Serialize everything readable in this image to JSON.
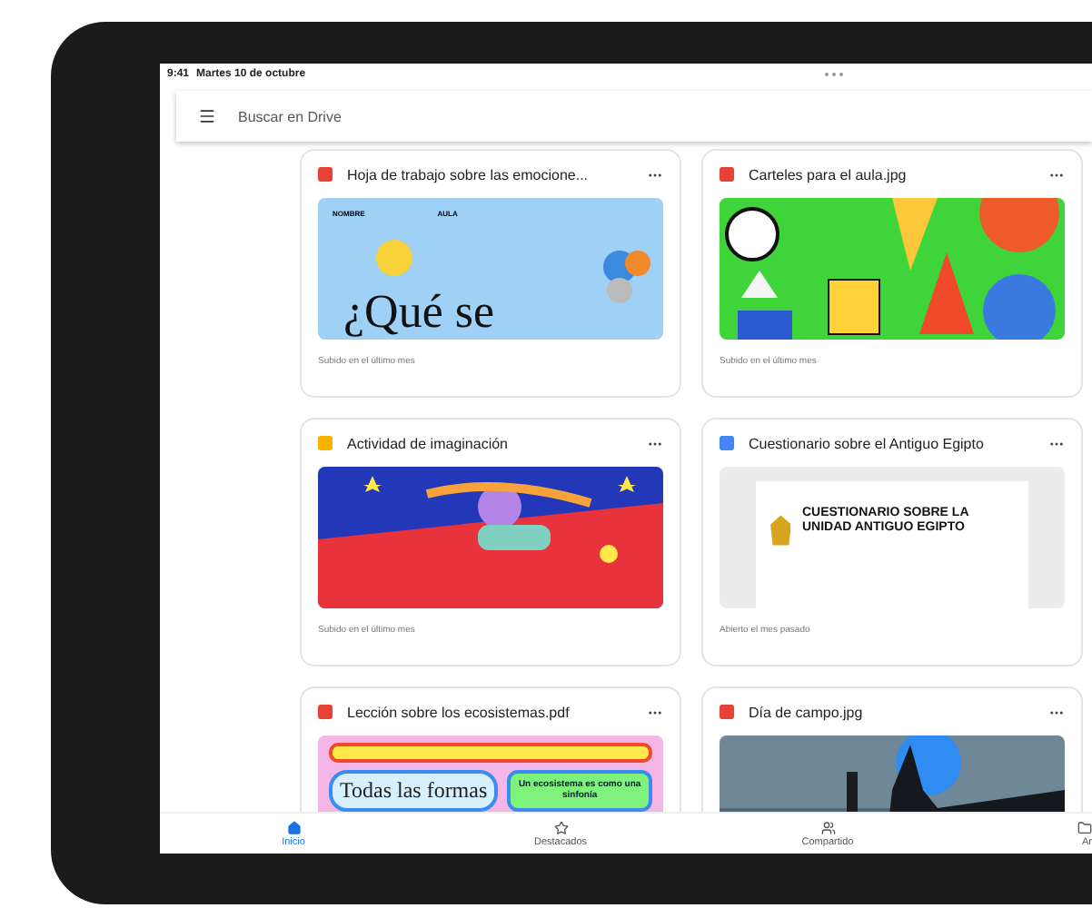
{
  "status_bar": {
    "time": "9:41",
    "date": "Martes 10 de octubre"
  },
  "search": {
    "placeholder": "Buscar en Drive"
  },
  "files": [
    {
      "name": "Hoja de trabajo sobre las emocione...",
      "caption": "Subido en el último mes",
      "thumbnail": {
        "kind": "worksheet",
        "labels": [
          "NOMBRE",
          "AULA"
        ],
        "headline": "¿Qué se"
      }
    },
    {
      "name": "Carteles para el aula.jpg",
      "caption": "Subido en el último mes"
    },
    {
      "name": "Actividad de imaginación",
      "caption": "Subido en el último mes"
    },
    {
      "name": "Cuestionario sobre el Antiguo Egipto",
      "caption": "Abierto el mes pasado",
      "thumbnail": {
        "kind": "document",
        "headline": "CUESTIONARIO SOBRE LA UNIDAD ANTIGUO EGIPTO"
      }
    },
    {
      "name": "Lección sobre los ecosistemas.pdf",
      "thumbnail": {
        "kind": "poster",
        "headline": "Todas las formas",
        "aside": "Un ecosistema es como una sinfonía"
      }
    },
    {
      "name": "Día de campo.jpg"
    }
  ],
  "nav": [
    {
      "label": "Inicio",
      "selected": true
    },
    {
      "label": "Destacados",
      "selected": false
    },
    {
      "label": "Compartido",
      "selected": false
    },
    {
      "label": "Ar",
      "selected": false
    }
  ]
}
